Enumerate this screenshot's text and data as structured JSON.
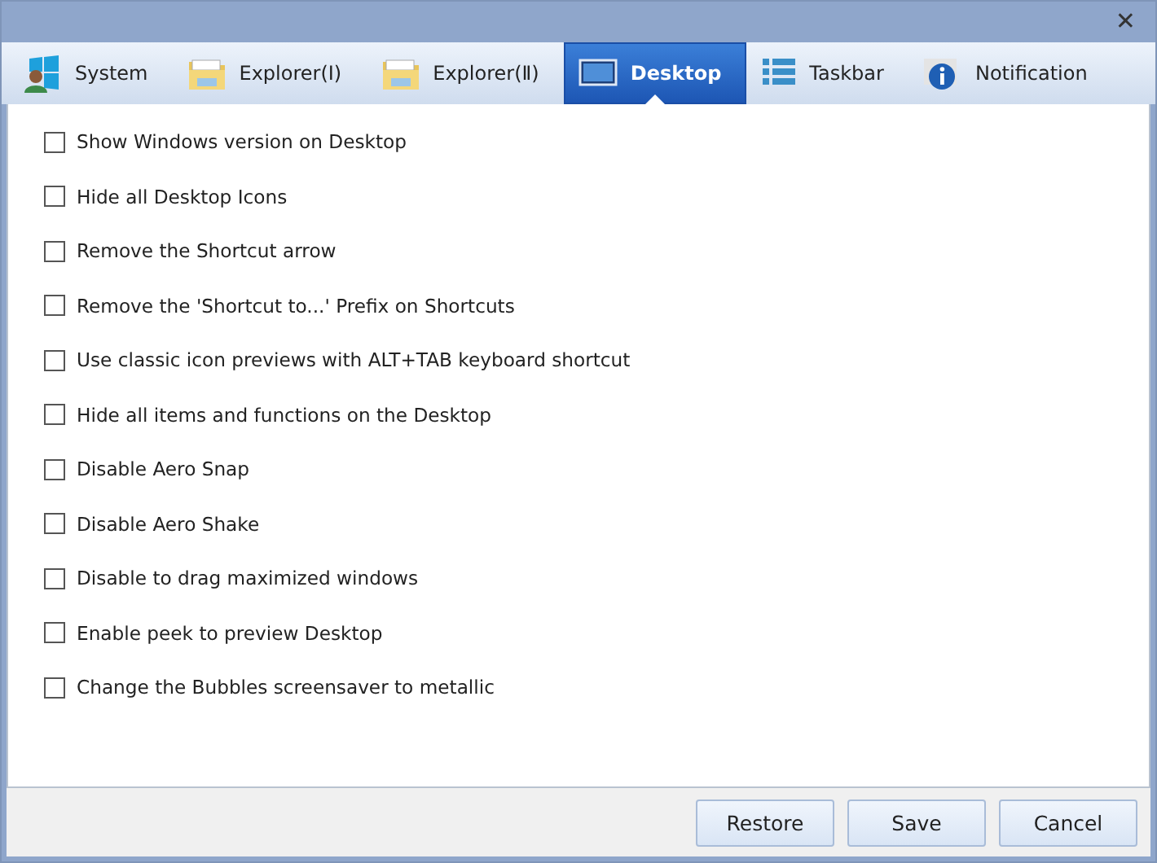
{
  "window": {
    "close": "✕"
  },
  "tabs": [
    {
      "label": "System",
      "kind": "system",
      "selected": false
    },
    {
      "label": "Explorer(Ⅰ)",
      "kind": "folder",
      "selected": false
    },
    {
      "label": "Explorer(Ⅱ)",
      "kind": "folder",
      "selected": false
    },
    {
      "label": "Desktop",
      "kind": "monitor",
      "selected": true
    },
    {
      "label": "Taskbar",
      "kind": "list",
      "selected": false
    },
    {
      "label": "Notification",
      "kind": "info",
      "selected": false
    }
  ],
  "options": [
    {
      "label": "Show Windows version on Desktop",
      "checked": false
    },
    {
      "label": "Hide all Desktop Icons",
      "checked": false
    },
    {
      "label": "Remove the Shortcut arrow",
      "checked": false
    },
    {
      "label": "Remove the 'Shortcut to...' Prefix on Shortcuts",
      "checked": false
    },
    {
      "label": "Use classic icon previews with ALT+TAB keyboard shortcut",
      "checked": false
    },
    {
      "label": "Hide all items and functions on the Desktop",
      "checked": false
    },
    {
      "label": "Disable Aero Snap",
      "checked": false
    },
    {
      "label": "Disable Aero Shake",
      "checked": false
    },
    {
      "label": "Disable to drag maximized windows",
      "checked": false
    },
    {
      "label": "Enable peek to preview Desktop",
      "checked": false
    },
    {
      "label": "Change the Bubbles screensaver to metallic",
      "checked": false
    }
  ],
  "buttons": [
    "Restore",
    "Save",
    "Cancel"
  ]
}
